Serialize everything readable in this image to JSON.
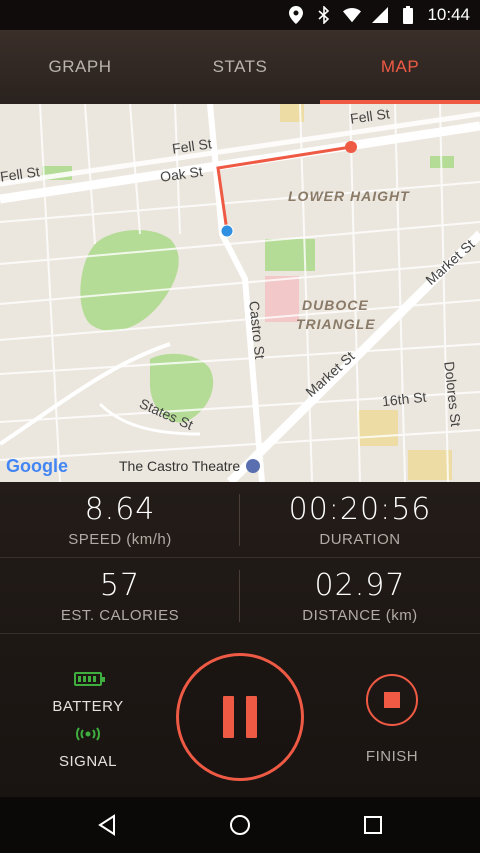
{
  "status_bar": {
    "time": "10:44",
    "icons": [
      "location-icon",
      "bluetooth-icon",
      "wifi-icon",
      "cell-signal-icon",
      "battery-icon"
    ]
  },
  "tabs": [
    {
      "label": "GRAPH",
      "active": false
    },
    {
      "label": "STATS",
      "active": false
    },
    {
      "label": "MAP",
      "active": true
    }
  ],
  "map": {
    "streets": [
      "Fell St",
      "Fell St",
      "Fell St",
      "Oak St",
      "Castro St",
      "Market St",
      "Market St",
      "16th St",
      "Dolores St",
      "States St"
    ],
    "areas": [
      "LOWER HAIGHT",
      "DUBOCE",
      "TRIANGLE"
    ],
    "poi": "The Castro Theatre",
    "logo": "Google",
    "route_color": "#ef5a45",
    "start_color": "#2f8fe0"
  },
  "stats": {
    "speed": {
      "value": "8.64",
      "label": "SPEED (km/h)"
    },
    "duration": {
      "value": "00:20:56",
      "label": "DURATION"
    },
    "calories": {
      "value": "57",
      "label": "EST. CALORIES"
    },
    "distance": {
      "value": "02.97",
      "label": "DISTANCE (km)"
    }
  },
  "controls": {
    "battery_label": "BATTERY",
    "signal_label": "SIGNAL",
    "finish_label": "FINISH",
    "accent_color": "#ef5a45",
    "ok_color": "#3fae3f"
  },
  "navbar": {
    "buttons": [
      "back-icon",
      "home-icon",
      "recents-icon"
    ]
  }
}
